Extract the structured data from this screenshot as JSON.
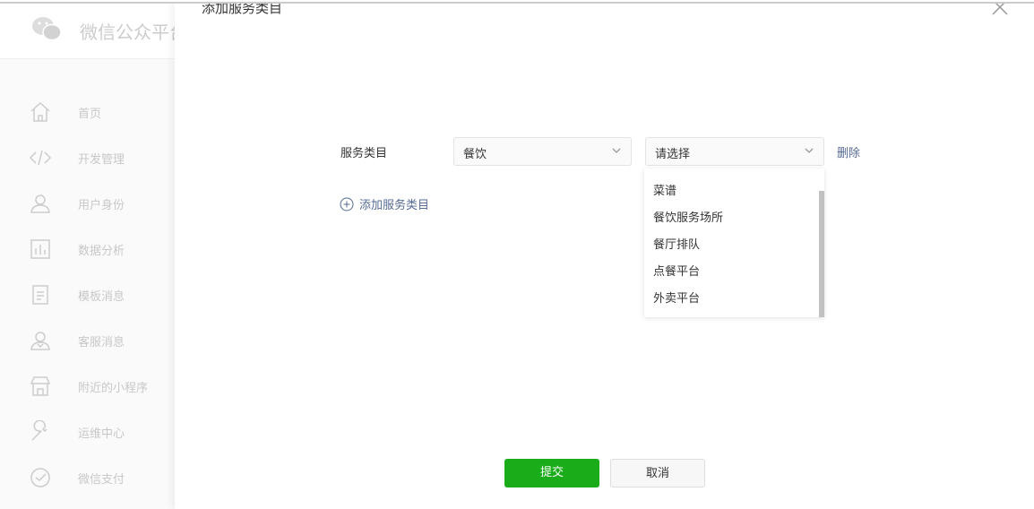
{
  "sidebar": {
    "brand": "微信公众平台",
    "items": [
      {
        "label": "首页",
        "icon": "home-icon"
      },
      {
        "label": "开发管理",
        "icon": "code-icon"
      },
      {
        "label": "用户身份",
        "icon": "user-icon"
      },
      {
        "label": "数据分析",
        "icon": "chart-icon"
      },
      {
        "label": "模板消息",
        "icon": "document-icon"
      },
      {
        "label": "客服消息",
        "icon": "service-icon"
      },
      {
        "label": "附近的小程序",
        "icon": "store-icon"
      },
      {
        "label": "运维中心",
        "icon": "wrench-icon"
      },
      {
        "label": "微信支付",
        "icon": "pay-icon"
      }
    ]
  },
  "modal": {
    "title": "添加服务类目",
    "field_label": "服务类目",
    "first_select": "餐饮",
    "second_select_placeholder": "请选择",
    "delete": "删除",
    "add_category": "添加服务类目",
    "options": [
      "菜谱",
      "餐饮服务场所",
      "餐厅排队",
      "点餐平台",
      "外卖平台"
    ],
    "submit": "提交",
    "cancel": "取消"
  }
}
